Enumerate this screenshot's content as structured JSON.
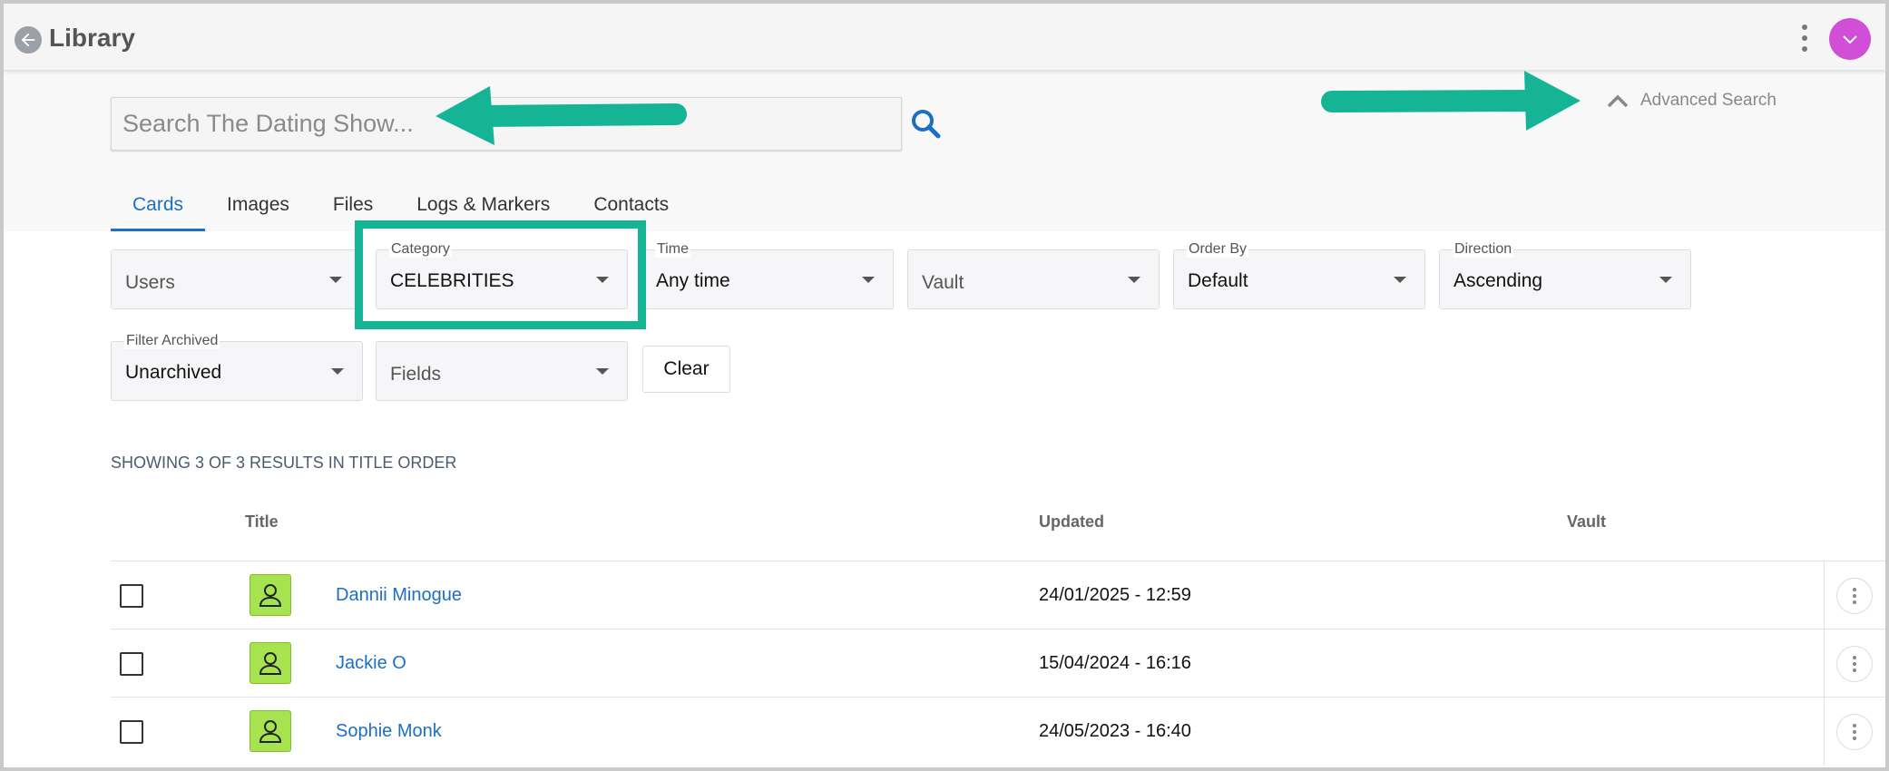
{
  "header": {
    "title": "Library"
  },
  "search": {
    "placeholder": "Search The Dating Show...",
    "advanced_label": "Advanced Search"
  },
  "tabs": [
    {
      "label": "Cards",
      "active": true
    },
    {
      "label": "Images",
      "active": false
    },
    {
      "label": "Files",
      "active": false
    },
    {
      "label": "Logs & Markers",
      "active": false
    },
    {
      "label": "Contacts",
      "active": false
    }
  ],
  "filters": {
    "users": {
      "label": "",
      "value": "Users"
    },
    "category": {
      "label": "Category",
      "value": "CELEBRITIES"
    },
    "time": {
      "label": "Time",
      "value": "Any time"
    },
    "vault": {
      "label": "",
      "value": "Vault"
    },
    "order_by": {
      "label": "Order By",
      "value": "Default"
    },
    "direction": {
      "label": "Direction",
      "value": "Ascending"
    },
    "filter_archived": {
      "label": "Filter Archived",
      "value": "Unarchived"
    },
    "fields": {
      "label": "",
      "value": "Fields"
    },
    "clear_label": "Clear"
  },
  "results": {
    "summary": "SHOWING 3 OF 3 RESULTS IN TITLE ORDER"
  },
  "table": {
    "columns": [
      "Title",
      "Updated",
      "Vault"
    ],
    "rows": [
      {
        "title": "Dannii Minogue",
        "updated": "24/01/2025 - 12:59",
        "vault": ""
      },
      {
        "title": "Jackie O",
        "updated": "15/04/2024 - 16:16",
        "vault": ""
      },
      {
        "title": "Sophie Monk",
        "updated": "24/05/2023 - 16:40",
        "vault": ""
      }
    ]
  },
  "colors": {
    "accent": "#1d6fc4",
    "annotation": "#14b494",
    "avatar": "#d04fd6",
    "card_icon": "#a6e34f"
  },
  "icons": {
    "back": "arrow-left-icon",
    "search": "magnifier-icon",
    "advanced": "chevron-up-icon",
    "menu": "more-vertical-icon",
    "avatar": "chevron-down-icon",
    "card": "person-icon"
  }
}
